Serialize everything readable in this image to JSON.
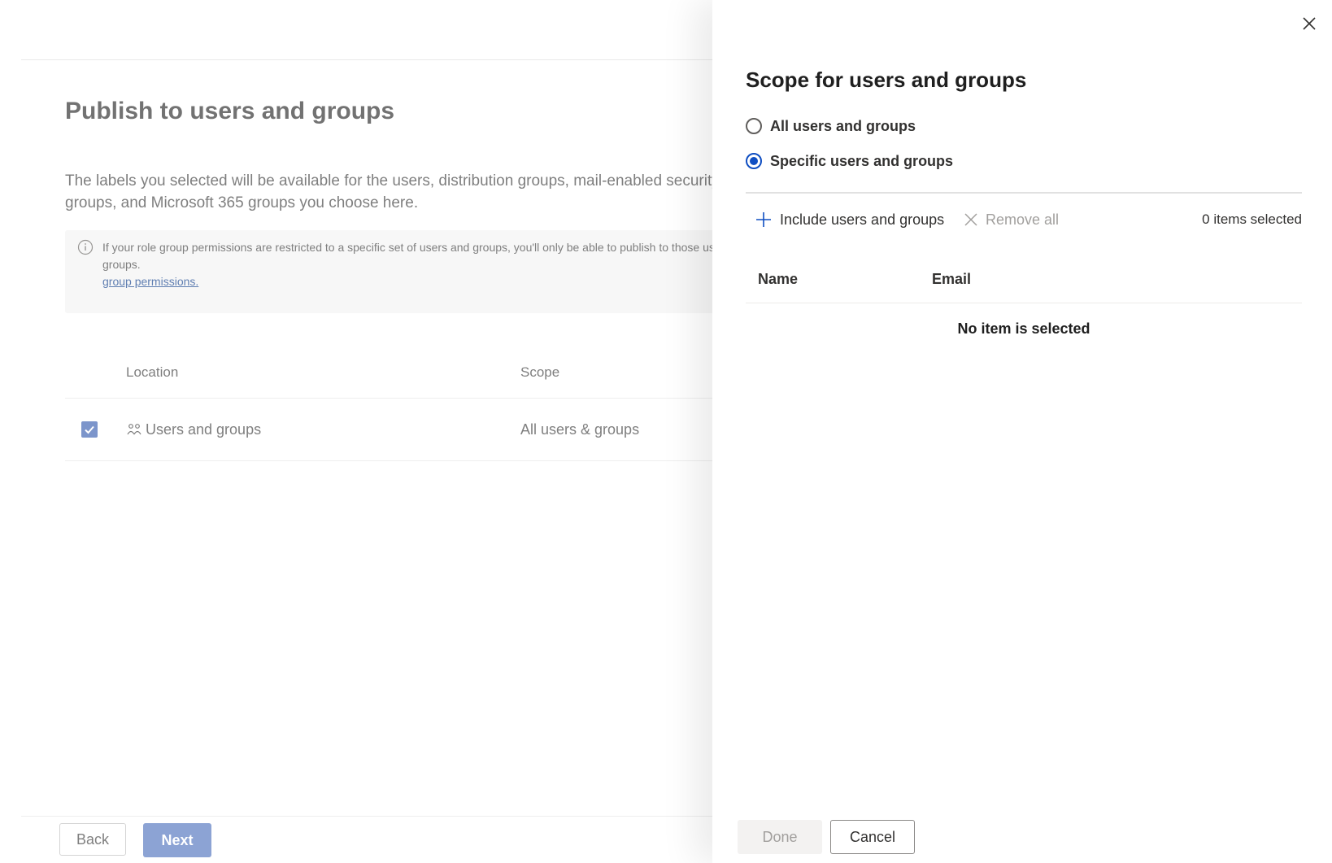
{
  "background_page": {
    "title": "Publish to users and groups",
    "description": "The labels you selected will be available for the users, distribution groups, mail-enabled security groups, and Microsoft 365 groups you choose here.",
    "info_text": "If your role group permissions are restricted to a specific set of users and groups, you'll only be able to publish to those users and groups.",
    "info_link": "group permissions.",
    "columns": {
      "location": "Location",
      "scope": "Scope"
    },
    "rows": [
      {
        "checked": true,
        "location": "Users and groups",
        "scope": "All users & groups"
      }
    ],
    "buttons": {
      "back": "Back",
      "next": "Next"
    }
  },
  "panel": {
    "title": "Scope for users and groups",
    "radio_options": [
      {
        "label": "All users and groups",
        "selected": false
      },
      {
        "label": "Specific users and groups",
        "selected": true
      }
    ],
    "commands": {
      "include": "Include users and groups",
      "remove_all": "Remove all",
      "items_selected": "0 items selected"
    },
    "table": {
      "columns": [
        "Name",
        "Email"
      ],
      "empty_message": "No item is selected"
    },
    "buttons": {
      "done": "Done",
      "cancel": "Cancel"
    }
  },
  "colors": {
    "accent": "#0f4ec2",
    "next_button": "#7d97cf",
    "checkbox": "#6a87c4",
    "disabled_text": "#a19f9d"
  },
  "icons": [
    "close-icon",
    "info-icon",
    "plus-icon",
    "x-icon",
    "users-icon",
    "checkmark-icon"
  ]
}
